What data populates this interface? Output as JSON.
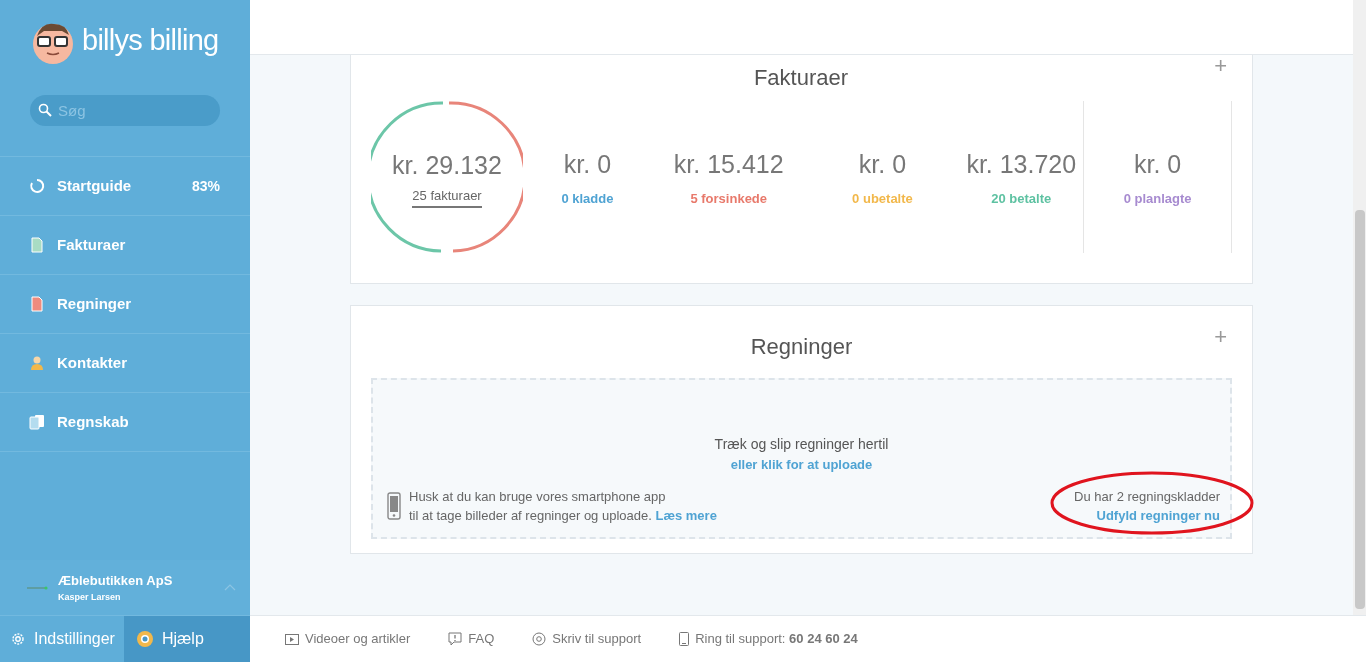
{
  "sidebar": {
    "logo": "billys billing",
    "search": {
      "placeholder": "Søg"
    },
    "items": [
      {
        "label": "Startguide",
        "kind": "progress",
        "badge": "83%",
        "selected": false
      },
      {
        "label": "Fakturaer",
        "kind": "invoice",
        "selected": false
      },
      {
        "label": "Regninger",
        "kind": "bill",
        "selected": false
      },
      {
        "label": "Kontakter",
        "kind": "contact",
        "selected": false
      },
      {
        "label": "Regnskab",
        "kind": "ledger",
        "selected": false
      }
    ],
    "company": {
      "name": "Æblebutikken ApS",
      "user": "Kasper Larsen"
    },
    "bottom": [
      {
        "label": "Indstillinger",
        "kind": "settings",
        "selected": false
      },
      {
        "label": "Hjælp",
        "kind": "help",
        "selected": true
      }
    ]
  },
  "invoices": {
    "title": "Fakturaer",
    "add": "+",
    "total": {
      "amount": "kr. 29.132",
      "link": "25 fakturaer"
    },
    "stats": [
      {
        "amount": "kr. 0",
        "label": "0 kladde",
        "color": "#4fa3d3"
      },
      {
        "amount": "kr. 15.412",
        "label": "5 forsinkede",
        "color": "#e8796b"
      },
      {
        "amount": "kr. 0",
        "label": "0 ubetalte",
        "color": "#f2b84b"
      },
      {
        "amount": "kr. 13.720",
        "label": "20 betalte",
        "color": "#5ec2a2"
      },
      {
        "amount": "kr. 0",
        "label": "0 planlagte",
        "color": "#a78bd0"
      }
    ]
  },
  "bills": {
    "title": "Regninger",
    "add": "+",
    "drop_title": "Træk og slip regninger hertil",
    "drop_link": "eller klik for at uploade",
    "app_line1": "Husk at du kan bruge vores smartphone app",
    "app_line2": "til at tage billeder af regninger og uploade.",
    "app_link": "Læs mere",
    "drafts": "Du har 2 regningskladder",
    "drafts_link": "Udfyld regninger nu"
  },
  "footer": [
    {
      "label": "Videoer og artikler",
      "kind": "video"
    },
    {
      "label": "FAQ",
      "kind": "faq"
    },
    {
      "label": "Skriv til support",
      "kind": "mail"
    },
    {
      "label": "Ring til support: **60 24 60 24**",
      "kind": "phone"
    }
  ]
}
